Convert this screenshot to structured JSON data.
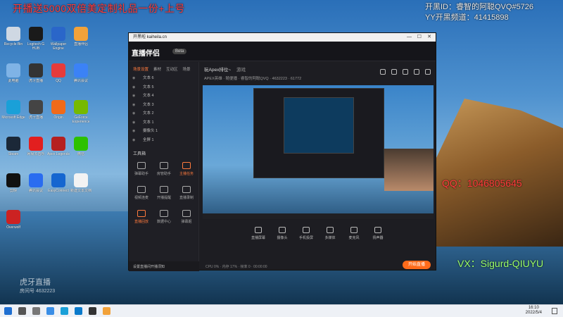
{
  "overlay": {
    "red_banner": "开播送5000双倍美定制礼品一份+上号",
    "kaihei_id": "开黑ID：睿智的阿聪QVQ#5726",
    "yy_channel": "YY开黑频道：41415898",
    "qq": "QQ：1046805645",
    "vx": "VX：Sigurd-QIUYU"
  },
  "watermark": {
    "brand": "虎牙直播",
    "room_label": "房间号",
    "room_id": "4632223"
  },
  "desktop_icons": [
    {
      "label": "Recycle Bin",
      "icon": "recycle-bin-icon",
      "color": "#cfd8e3"
    },
    {
      "label": "Logitech G HUB",
      "icon": "app-icon",
      "color": "#1a1a1a"
    },
    {
      "label": "Wallpaper Engine",
      "icon": "app-icon",
      "color": "#2a66c9"
    },
    {
      "label": "直播伴侣",
      "icon": "app-icon",
      "color": "#f2a23a"
    },
    {
      "label": "此电脑",
      "icon": "computer-icon",
      "color": "#7fb3e6"
    },
    {
      "label": "虎牙直播",
      "icon": "app-icon",
      "color": "#333"
    },
    {
      "label": "QQ",
      "icon": "qq-icon",
      "color": "#e63b3b"
    },
    {
      "label": "腾讯会议",
      "icon": "app-icon",
      "color": "#3b82f6"
    },
    {
      "label": "Microsoft Edge",
      "icon": "edge-icon",
      "color": "#1aa0d8"
    },
    {
      "label": "虎牙直播",
      "icon": "app-icon",
      "color": "#444"
    },
    {
      "label": "Origin",
      "icon": "origin-icon",
      "color": "#f06a1a"
    },
    {
      "label": "GeForce Experience",
      "icon": "nvidia-icon",
      "color": "#76b900"
    },
    {
      "label": "Steam",
      "icon": "steam-icon",
      "color": "#1b2838"
    },
    {
      "label": "网易云音乐",
      "icon": "music-icon",
      "color": "#e21f1f"
    },
    {
      "label": "Apex Legends",
      "icon": "apex-icon",
      "color": "#b52020"
    },
    {
      "label": "微信",
      "icon": "wechat-icon",
      "color": "#2dc100"
    },
    {
      "label": "剪映",
      "icon": "capcut-icon",
      "color": "#111"
    },
    {
      "label": "腾讯会议",
      "icon": "app-icon",
      "color": "#2a6cf0"
    },
    {
      "label": "EasyConnect",
      "icon": "app-icon",
      "color": "#1566d0"
    },
    {
      "label": "新建文本文档",
      "icon": "document-icon",
      "color": "#f3f3f3"
    },
    {
      "label": "Overwolf",
      "icon": "app-icon",
      "color": "#c22"
    }
  ],
  "window": {
    "title": "开黑啦 kaiheila.cn",
    "app_name": "直播伴侣",
    "beta": "Beta",
    "sidebar_tabs": [
      "场景设置",
      "素材",
      "互动区",
      "场景"
    ],
    "layers": [
      "文本 6",
      "文本 5",
      "文本 4",
      "文本 3",
      "文本 2",
      "文本 1",
      "摄像头 1",
      "全屏 1"
    ],
    "tools_label": "工具箱",
    "tools": [
      {
        "label": "弹幕助手",
        "hot": false
      },
      {
        "label": "房管助手",
        "hot": false
      },
      {
        "label": "主播任务",
        "hot": true
      },
      {
        "label": "视频连麦",
        "hot": false
      },
      {
        "label": "开播提醒",
        "hot": false
      },
      {
        "label": "直播录制",
        "hot": false
      },
      {
        "label": "直播回放",
        "hot": true
      },
      {
        "label": "数据中心",
        "hot": false
      },
      {
        "label": "弹幕姬",
        "hot": false
      }
    ],
    "announcement": "设置直播间开播须知",
    "stream_title": "玩Apex排位~",
    "stream_tag": "游戏",
    "stream_meta": "APEX英雄 · 随便播 · 睿智的阿聪QVQ · 4632223 · 61772",
    "controls": [
      "直播屏幕",
      "摄像头",
      "手机投屏",
      "多媒体",
      "麦克风",
      "扬声器"
    ],
    "go_live": "开始直播",
    "status": "CPU 0% · 内存 17% · 帧率 0 · 00:00:00"
  },
  "taskbar": {
    "time": "16:10",
    "date": "2022/5/4"
  }
}
